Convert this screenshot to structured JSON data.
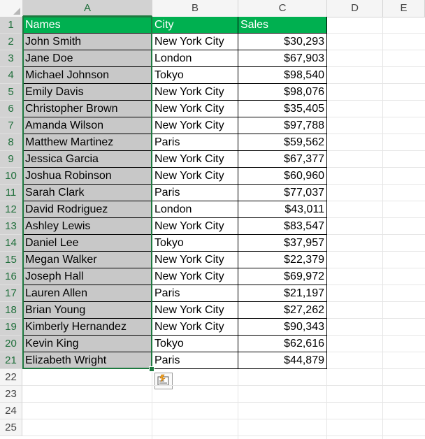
{
  "columns": [
    "A",
    "B",
    "C",
    "D",
    "E"
  ],
  "row_numbers": [
    "1",
    "2",
    "3",
    "4",
    "5",
    "6",
    "7",
    "8",
    "9",
    "10",
    "11",
    "12",
    "13",
    "14",
    "15",
    "16",
    "17",
    "18",
    "19",
    "20",
    "21",
    "22",
    "23",
    "24",
    "25"
  ],
  "header": {
    "names": "Names",
    "city": "City",
    "sales": "Sales"
  },
  "rows": [
    {
      "name": "John Smith",
      "city": "New York City",
      "sales": "$30,293"
    },
    {
      "name": "Jane Doe",
      "city": "London",
      "sales": "$67,903"
    },
    {
      "name": "Michael Johnson",
      "city": "Tokyo",
      "sales": "$98,540"
    },
    {
      "name": "Emily Davis",
      "city": "New York City",
      "sales": "$98,076"
    },
    {
      "name": "Christopher Brown",
      "city": "New York City",
      "sales": "$35,405"
    },
    {
      "name": "Amanda Wilson",
      "city": "New York City",
      "sales": "$97,788"
    },
    {
      "name": "Matthew Martinez",
      "city": "Paris",
      "sales": "$59,562"
    },
    {
      "name": "Jessica Garcia",
      "city": "New York City",
      "sales": "$67,377"
    },
    {
      "name": "Joshua Robinson",
      "city": "New York City",
      "sales": "$60,960"
    },
    {
      "name": "Sarah Clark",
      "city": "Paris",
      "sales": "$77,037"
    },
    {
      "name": "David Rodriguez",
      "city": "London",
      "sales": "$43,011"
    },
    {
      "name": "Ashley Lewis",
      "city": "New York City",
      "sales": "$83,547"
    },
    {
      "name": "Daniel Lee",
      "city": "Tokyo",
      "sales": "$37,957"
    },
    {
      "name": "Megan Walker",
      "city": "New York City",
      "sales": "$22,379"
    },
    {
      "name": "Joseph Hall",
      "city": "New York City",
      "sales": "$69,972"
    },
    {
      "name": "Lauren Allen",
      "city": "Paris",
      "sales": "$21,197"
    },
    {
      "name": "Brian Young",
      "city": "New York City",
      "sales": "$27,262"
    },
    {
      "name": "Kimberly Hernandez",
      "city": "New York City",
      "sales": "$90,343"
    },
    {
      "name": "Kevin King",
      "city": "Tokyo",
      "sales": "$62,616"
    },
    {
      "name": "Elizabeth Wright",
      "city": "Paris",
      "sales": "$44,879"
    }
  ],
  "selection": {
    "column": "A",
    "first_row": 1,
    "last_row": 21
  },
  "icons": {
    "quick_analysis": "quick-analysis-icon",
    "select_all": "select-all-triangle-icon"
  },
  "colors": {
    "header_fill": "#00b050",
    "header_text": "#ffffff",
    "selection_fill": "#c8c8c8",
    "selection_border": "#1e7a40"
  }
}
